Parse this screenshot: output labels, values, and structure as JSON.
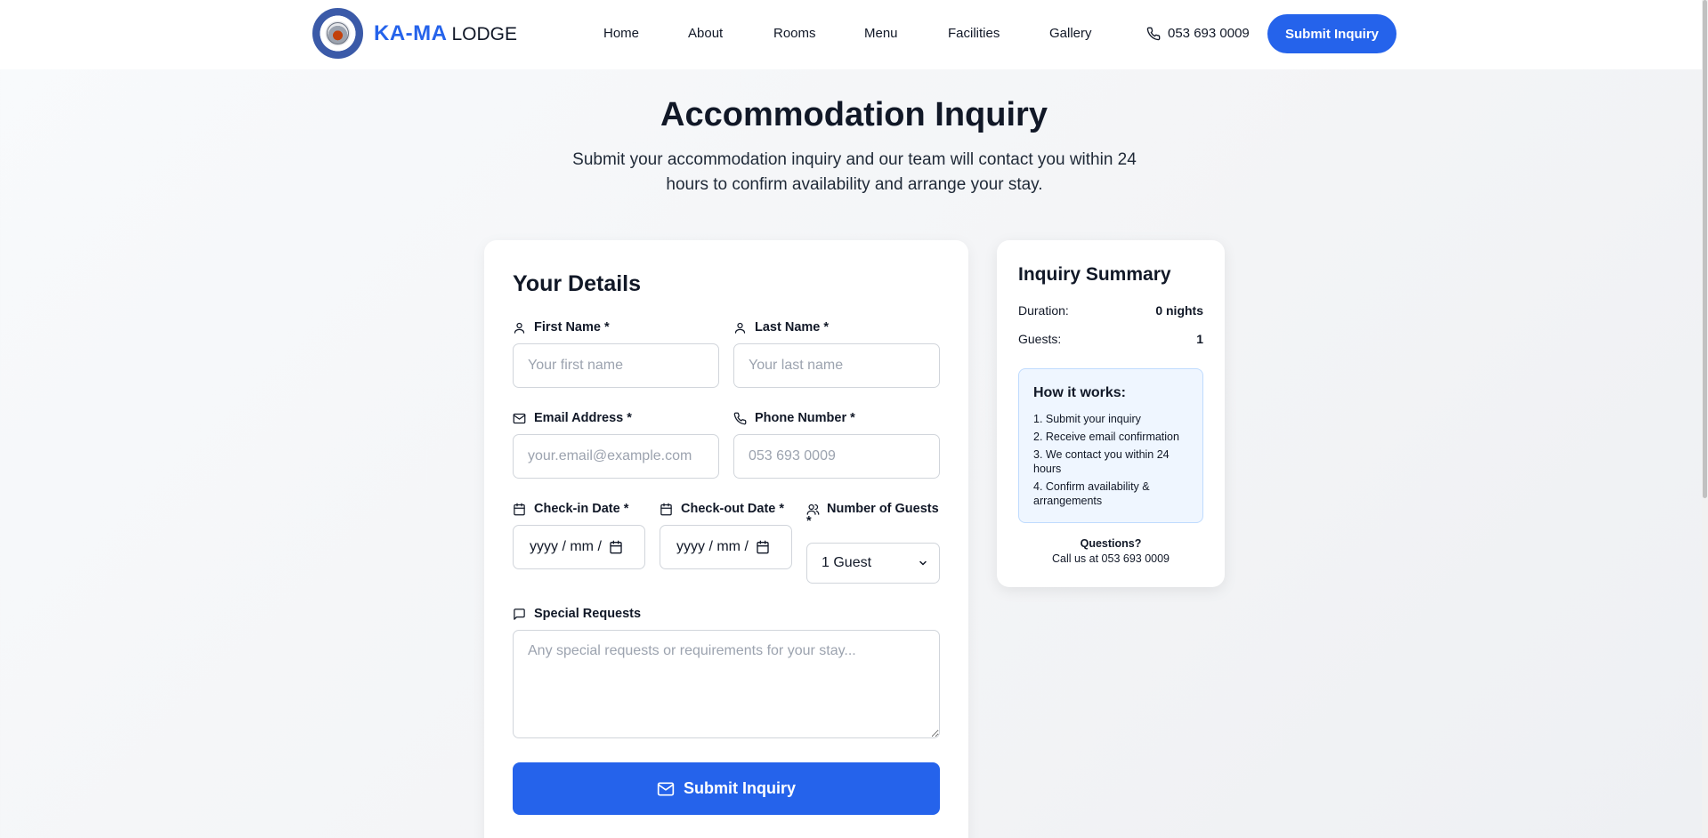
{
  "header": {
    "brand_primary": "KA-MA",
    "brand_secondary": "LODGE",
    "nav": [
      "Home",
      "About",
      "Rooms",
      "Menu",
      "Facilities",
      "Gallery"
    ],
    "phone": "053 693 0009",
    "cta": "Submit Inquiry"
  },
  "hero": {
    "title": "Accommodation Inquiry",
    "subtitle": "Submit your accommodation inquiry and our team will contact you within 24 hours to confirm availability and arrange your stay."
  },
  "form": {
    "title": "Your Details",
    "first_name_label": "First Name *",
    "first_name_placeholder": "Your first name",
    "last_name_label": "Last Name *",
    "last_name_placeholder": "Your last name",
    "email_label": "Email Address *",
    "email_placeholder": "your.email@example.com",
    "phone_label": "Phone Number *",
    "phone_placeholder": "053 693 0009",
    "checkin_label": "Check-in Date *",
    "checkin_placeholder": "yyyy / mm /",
    "checkout_label": "Check-out Date *",
    "checkout_placeholder": "yyyy / mm /",
    "guests_label_line1": "Number of Guests",
    "guests_label_line2": "*",
    "guests_value": "1 Guest",
    "requests_label": "Special Requests",
    "requests_placeholder": "Any special requests or requirements for your stay...",
    "submit_label": "Submit Inquiry"
  },
  "summary": {
    "title": "Inquiry Summary",
    "duration_label": "Duration:",
    "duration_value": "0 nights",
    "guests_label": "Guests:",
    "guests_value": "1",
    "how_title": "How it works:",
    "how_steps": [
      "1. Submit your inquiry",
      "2. Receive email confirmation",
      "3. We contact you within 24 hours",
      "4. Confirm availability & arrangements"
    ],
    "questions_title": "Questions?",
    "questions_text": "Call us at 053 693 0009"
  },
  "colors": {
    "accent": "#2563eb",
    "info_bg": "#eff6ff",
    "info_border": "#bfdbfe"
  }
}
